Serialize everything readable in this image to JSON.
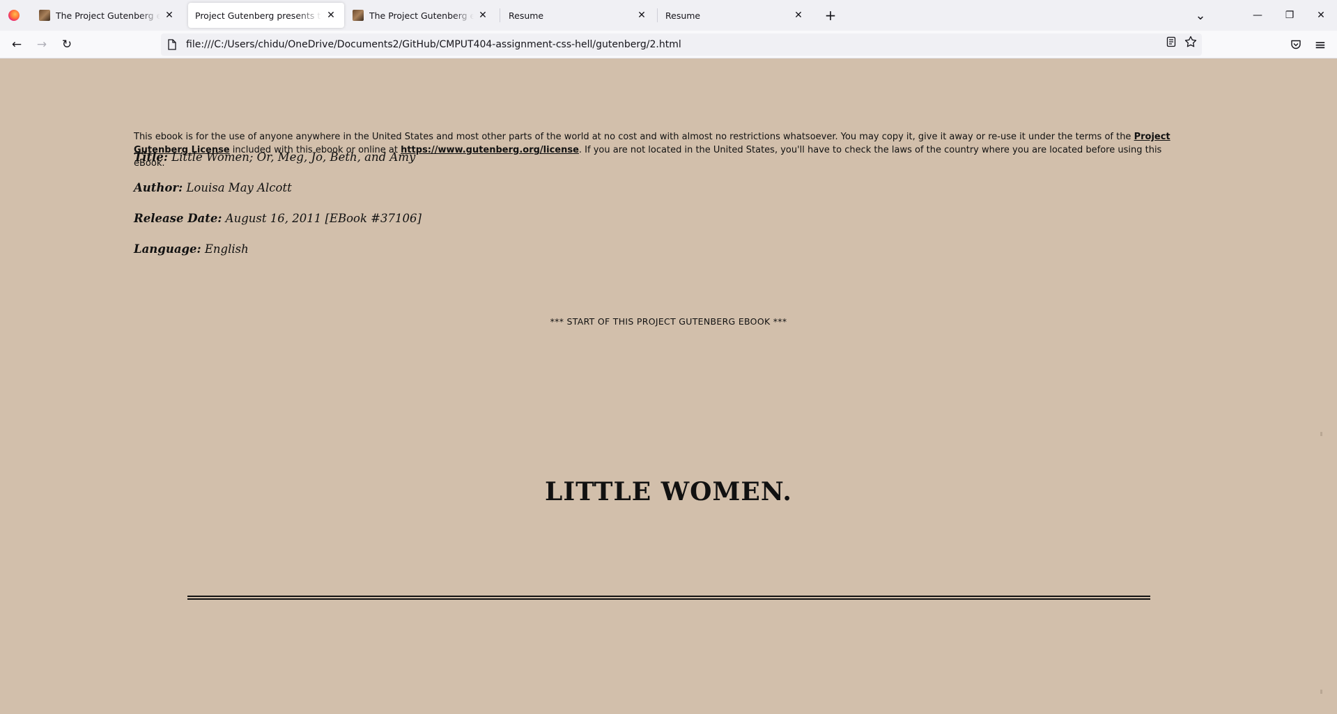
{
  "browser": {
    "tabs": [
      {
        "title": "The Project Gutenberg eBook of",
        "has_favicon": true,
        "active": false
      },
      {
        "title": "Project Gutenberg presents the Illu",
        "has_favicon": false,
        "active": true
      },
      {
        "title": "The Project Gutenberg eBook of",
        "has_favicon": true,
        "active": false
      },
      {
        "title": "Resume",
        "has_favicon": false,
        "active": false
      },
      {
        "title": "Resume",
        "has_favicon": false,
        "active": false
      }
    ],
    "close_glyph": "✕",
    "new_tab_glyph": "+",
    "list_tabs_glyph": "⌄",
    "window": {
      "minimize": "—",
      "restore": "❐",
      "close": "✕"
    },
    "nav": {
      "back": "←",
      "forward": "→",
      "reload": "↻"
    },
    "url": "file:///C:/Users/chidu/OneDrive/Documents2/GitHub/CMPUT404-assignment-css-hell/gutenberg/2.html",
    "menu_glyph": "≡",
    "colors": {
      "page_background": "#d2bfab",
      "tabbar": "#f0f0f4",
      "navbar": "#f9f9fb"
    }
  },
  "page": {
    "notice": {
      "part1": "This ebook is for the use of anyone anywhere in the United States and most other parts of the world at no cost and with almost no restrictions whatsoever. You may copy it, give it away or re-use it under the terms of the ",
      "license_link": "Project Gutenberg License",
      "part2": " included with this ebook or online at ",
      "url_link": "https://www.gutenberg.org/license",
      "part3": ". If you are not located in the United States, you'll have to check the laws of the country where you are located before using this eBook."
    },
    "meta": [
      {
        "label": "Title:",
        "value": " Little Women; Or, Meg, Jo, Beth, and Amy"
      },
      {
        "label": "Author:",
        "value": " Louisa May Alcott"
      },
      {
        "label": "Release Date:",
        "value": " August 16, 2011 [EBook #37106]"
      },
      {
        "label": "Language:",
        "value": " English"
      }
    ],
    "start_marker": "*** START OF THIS PROJECT GUTENBERG EBOOK ***",
    "heading": "LITTLE WOMEN."
  }
}
